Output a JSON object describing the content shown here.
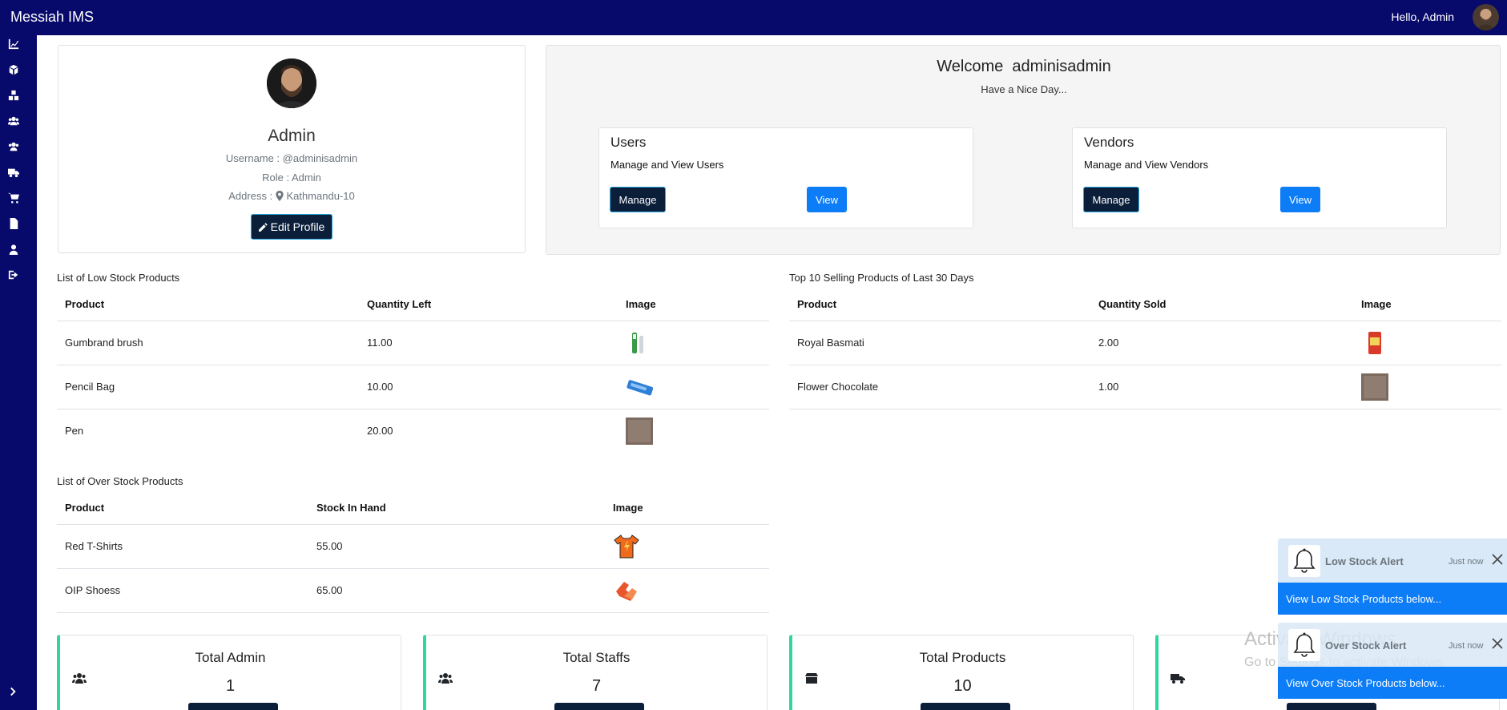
{
  "header": {
    "brand": "Messiah IMS",
    "greeting": "Hello, Admin"
  },
  "sidebar": {
    "items": [
      {
        "icon": "chart-line-icon"
      },
      {
        "icon": "box-icon"
      },
      {
        "icon": "cubes-icon"
      },
      {
        "icon": "users-icon"
      },
      {
        "icon": "user-group-icon"
      },
      {
        "icon": "truck-icon"
      },
      {
        "icon": "cart-icon"
      },
      {
        "icon": "file-icon"
      },
      {
        "icon": "user-icon"
      },
      {
        "icon": "sign-out-icon"
      }
    ],
    "collapse_icon": "chevron-right-icon"
  },
  "profile": {
    "name": "Admin",
    "username": "Username : @adminisadmin",
    "role": "Role : Admin",
    "address_label": "Address :",
    "address": "Kathmandu-10",
    "edit_label": "Edit Profile"
  },
  "welcome": {
    "title": "Welcome  adminisadmin",
    "subtitle": "Have a Nice Day...",
    "cards": [
      {
        "title": "Users",
        "desc": "Manage and View Users",
        "manage": "Manage",
        "view": "View"
      },
      {
        "title": "Vendors",
        "desc": "Manage and View Vendors",
        "manage": "Manage",
        "view": "View"
      }
    ]
  },
  "low_stock": {
    "caption": "List of Low Stock Products",
    "headers": [
      "Product",
      "Quantity Left",
      "Image"
    ],
    "rows": [
      {
        "product": "Gumbrand brush",
        "qty": "11.00"
      },
      {
        "product": "Pencil Bag",
        "qty": "10.00"
      },
      {
        "product": "Pen",
        "qty": "20.00"
      }
    ]
  },
  "top_selling": {
    "caption": "Top 10 Selling Products of Last 30 Days",
    "headers": [
      "Product",
      "Quantity Sold",
      "Image"
    ],
    "rows": [
      {
        "product": "Royal Basmati",
        "qty": "2.00"
      },
      {
        "product": "Flower Chocolate",
        "qty": "1.00"
      }
    ]
  },
  "over_stock": {
    "caption": "List of Over Stock Products",
    "headers": [
      "Product",
      "Stock In Hand",
      "Image"
    ],
    "rows": [
      {
        "product": "Red T-Shirts",
        "qty": "55.00"
      },
      {
        "product": "OIP Shoess",
        "qty": "65.00"
      }
    ]
  },
  "stats": [
    {
      "title": "Total Admin",
      "value": "1",
      "icon": "users-icon"
    },
    {
      "title": "Total Staffs",
      "value": "7",
      "icon": "users-icon"
    },
    {
      "title": "Total Products",
      "value": "10",
      "icon": "box-icon"
    },
    {
      "title": "",
      "value": "",
      "icon": "truck-icon"
    }
  ],
  "toasts": [
    {
      "title": "Low Stock Alert",
      "time": "Just now",
      "body": "View Low Stock Products below..."
    },
    {
      "title": "Over Stock Alert",
      "time": "Just now",
      "body": "View Over Stock Products below..."
    }
  ],
  "watermark": {
    "line1": "Activate Windows",
    "line2": "Go to Settings to activate Windows."
  },
  "colors": {
    "navy": "#080a6b",
    "primary": "#0d7df7",
    "dark_button": "#0b1e3a",
    "accent_green": "#2fd6a0"
  }
}
